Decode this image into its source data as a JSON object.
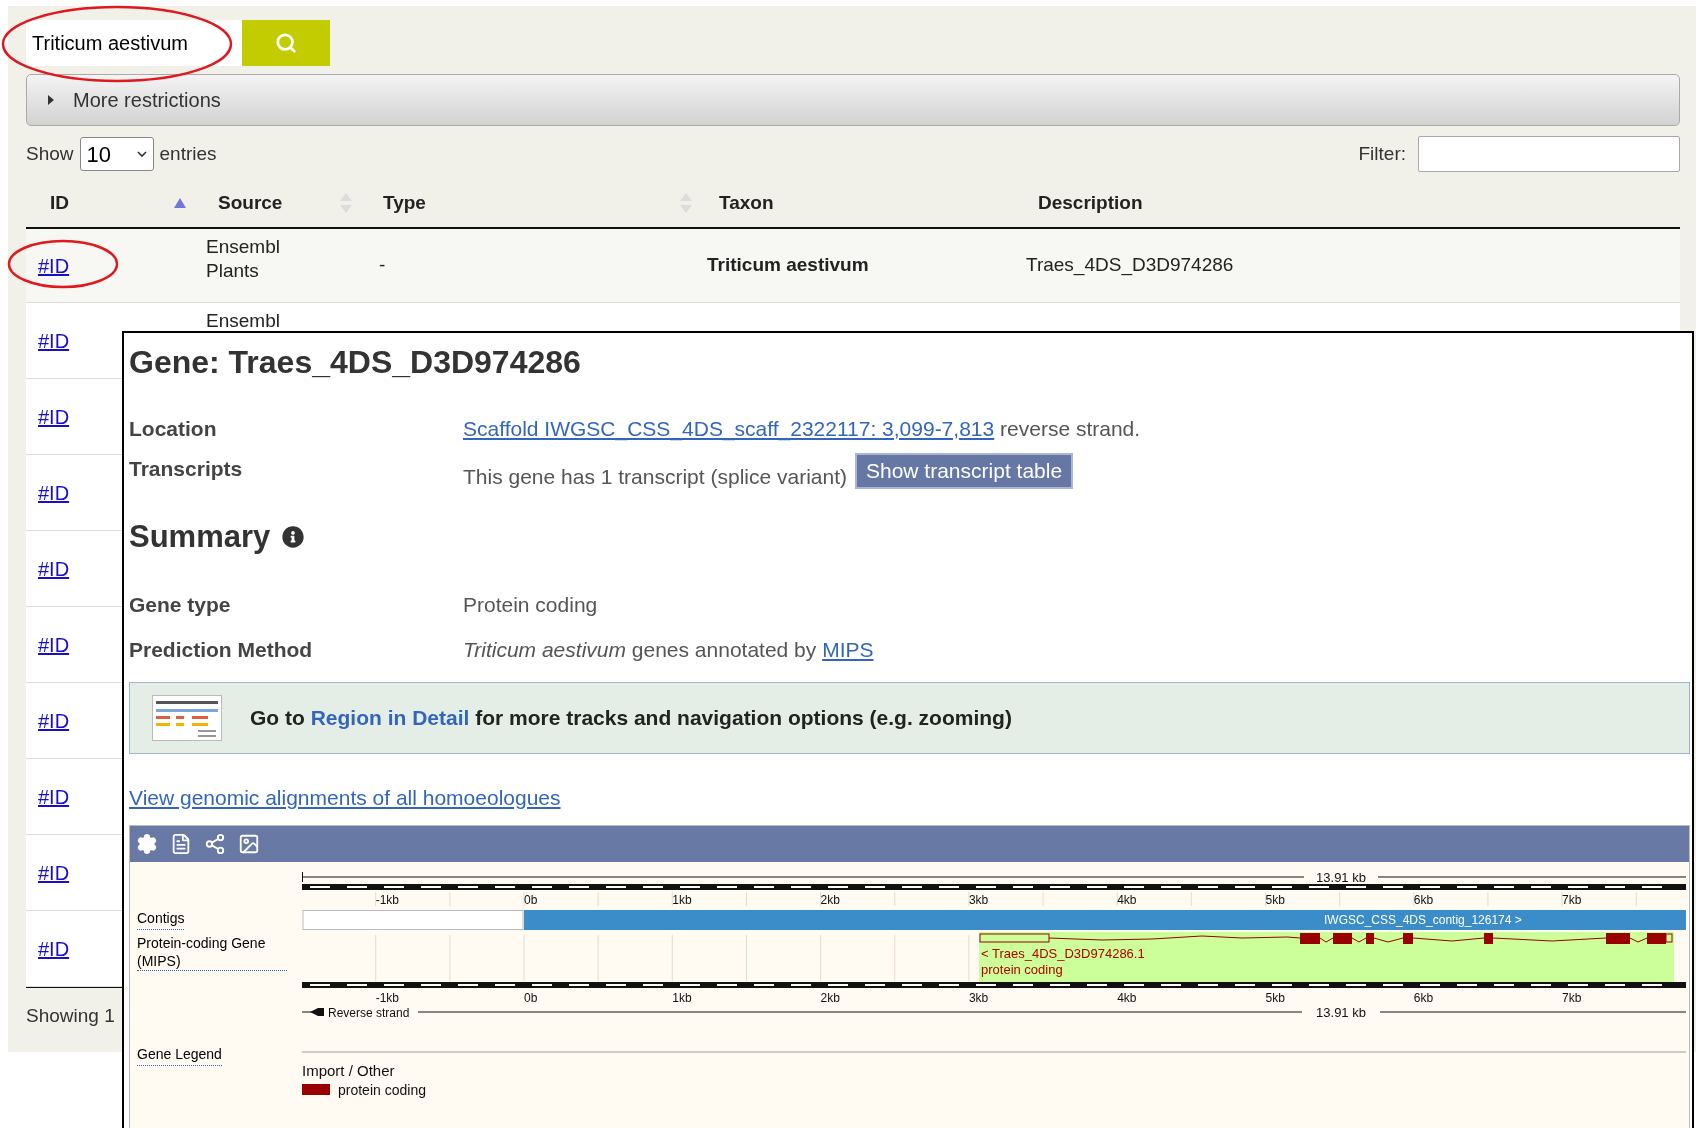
{
  "search": {
    "value": "Triticum aestivum"
  },
  "restrictions": {
    "label": "More restrictions",
    "expanded": false
  },
  "length_menu": {
    "before": "Show",
    "value": "10",
    "after": "entries"
  },
  "filter": {
    "label": "Filter:"
  },
  "table": {
    "columns": [
      {
        "label": "ID",
        "sorted": true
      },
      {
        "label": "Source",
        "sorted": false
      },
      {
        "label": "Type",
        "sorted": false
      },
      {
        "label": "Taxon"
      },
      {
        "label": "Description"
      }
    ],
    "rows": [
      {
        "id": "#ID",
        "source": "Ensembl Plants",
        "type": "-",
        "taxon": "Triticum aestivum",
        "description": "Traes_4DS_D3D974286"
      },
      {
        "id": "#ID",
        "source": "Ensembl"
      },
      {
        "id": "#ID"
      },
      {
        "id": "#ID"
      },
      {
        "id": "#ID"
      },
      {
        "id": "#ID"
      },
      {
        "id": "#ID"
      },
      {
        "id": "#ID"
      },
      {
        "id": "#ID"
      },
      {
        "id": "#ID"
      }
    ]
  },
  "info": "Showing 1",
  "gene": {
    "title": "Gene: Traes_4DS_D3D974286",
    "location": {
      "label": "Location",
      "link": "Scaffold IWGSC_CSS_4DS_scaff_2322117: 3,099-7,813",
      "suffix": "reverse strand."
    },
    "transcripts": {
      "label": "Transcripts",
      "text": "This gene has 1 transcript (splice variant)",
      "button": "Show transcript table"
    },
    "summary": "Summary",
    "gene_type": {
      "label": "Gene type",
      "value": "Protein coding"
    },
    "prediction": {
      "label": "Prediction Method",
      "value": "*Triticum aestivum* genes annotated by",
      "link": "MIPS"
    },
    "region_banner": {
      "before": "Go to",
      "link": "Region in Detail",
      "after": "for more tracks and navigation options (e.g. zooming)"
    },
    "homoeologues_link": "View genomic alignments of all homoeologues"
  },
  "browser": {
    "scale_label_top": "13.91 kb",
    "scale_label_bottom": "13.91 kb",
    "ticks_top": [
      "-1kb",
      "0b",
      "1kb",
      "2kb",
      "3kb",
      "4kb",
      "5kb",
      "6kb",
      "7kb"
    ],
    "ticks_bottom": [
      "-1kb",
      "0b",
      "1kb",
      "2kb",
      "3kb",
      "4kb",
      "5kb",
      "6kb",
      "7kb"
    ],
    "contigs_label": "Contigs",
    "gene_track_label": "Protein-coding Gene (MIPS)",
    "contig_name": "IWGSC_CSS_4DS_contig_126174 >",
    "transcript_name": "< Traes_4DS_D3D974286.1",
    "transcript_biotype": "protein coding",
    "strand": "Reverse strand",
    "legend": {
      "label": "Gene Legend",
      "heading": "Import / Other",
      "items": [
        {
          "label": "protein coding",
          "color": "#990000"
        }
      ]
    }
  }
}
